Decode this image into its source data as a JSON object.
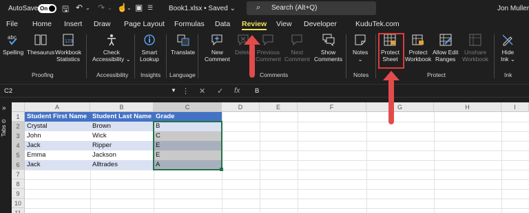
{
  "titlebar": {
    "autosave_label": "AutoSave",
    "toggle_label": "On",
    "document_title": "Book1.xlsx • Saved ⌄",
    "search_placeholder": "Search (Alt+Q)",
    "user_name": "Jon Muller"
  },
  "menu_tabs": [
    "File",
    "Home",
    "Insert",
    "Draw",
    "Page Layout",
    "Formulas",
    "Data",
    "Review",
    "View",
    "Developer",
    "KuduTek.com"
  ],
  "active_tab": "Review",
  "ribbon": {
    "spelling": "Spelling",
    "thesaurus": "Thesaurus",
    "workbook_statistics": [
      "Workbook",
      "Statistics"
    ],
    "check_accessibility": [
      "Check",
      "Accessibility ⌄"
    ],
    "smart_lookup": [
      "Smart",
      "Lookup"
    ],
    "translate": "Translate",
    "new_comment": [
      "New",
      "Comment"
    ],
    "delete": "Delete",
    "previous_comment": [
      "Previous",
      "Comment"
    ],
    "next_comment": [
      "Next",
      "Comment"
    ],
    "show_comments": [
      "Show",
      "Comments"
    ],
    "notes": [
      "Notes",
      "⌄"
    ],
    "protect_sheet": [
      "Protect",
      "Sheet"
    ],
    "protect_workbook": [
      "Protect",
      "Workbook"
    ],
    "allow_edit_ranges": [
      "Allow Edit",
      "Ranges"
    ],
    "unshare_workbook": [
      "Unshare",
      "Workbook"
    ],
    "hide_ink": [
      "Hide",
      "Ink ⌄"
    ],
    "groups": {
      "proofing": "Proofing",
      "accessibility": "Accessibility",
      "insights": "Insights",
      "language": "Language",
      "comments": "Comments",
      "notes": "Notes",
      "protect": "Protect",
      "ink": "Ink"
    }
  },
  "formula_bar": {
    "name_box": "C2",
    "fx": "fx",
    "value": "B"
  },
  "side_panel_label": "Tabs ⊙",
  "sheet": {
    "columns": [
      "A",
      "B",
      "C",
      "D",
      "E",
      "F",
      "G",
      "H",
      "I"
    ],
    "rows": [
      "1",
      "2",
      "3",
      "4",
      "5",
      "6",
      "7",
      "8",
      "9",
      "10",
      "11"
    ],
    "header_row": [
      "Student First Name",
      "Student Last Name",
      "Grade"
    ],
    "data_rows": [
      [
        "Crystal",
        "Brown",
        "B"
      ],
      [
        "John",
        "Wick",
        "C"
      ],
      [
        "Jack",
        "Ripper",
        "E"
      ],
      [
        "Emma",
        "Jackson",
        "E"
      ],
      [
        "Jack",
        "Alltrades",
        "A"
      ]
    ]
  },
  "colors": {
    "active_tab": "#f2e25b",
    "highlight_box": "#e13c3c",
    "arrow": "#e34b4b",
    "table_header": "#4472c4",
    "table_band": "#d9e1f2",
    "selection": "#a9a9a9"
  }
}
